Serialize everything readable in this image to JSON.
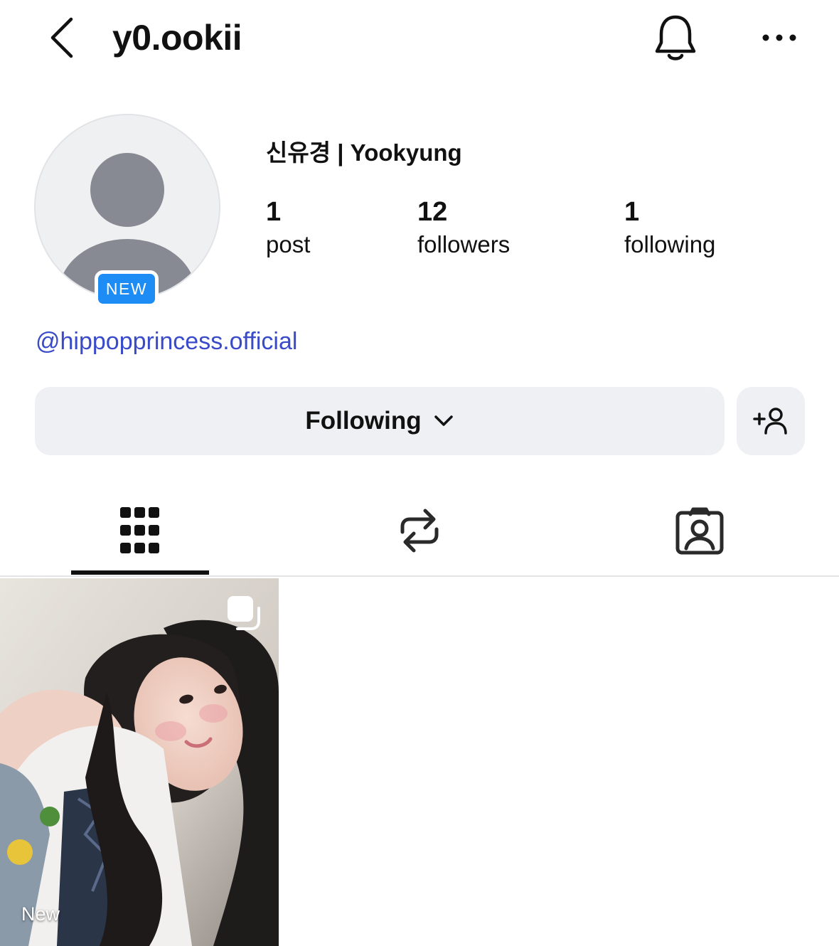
{
  "header": {
    "username": "y0.ookii",
    "back_icon": "chevron-left-icon",
    "notification_icon": "bell-icon",
    "more_icon": "more-horizontal-icon"
  },
  "profile": {
    "display_name": "신유경 | Yookyung",
    "avatar_badge": "NEW",
    "link": "@hippopprincess.official",
    "stats": {
      "posts": {
        "count": "1",
        "label": "post"
      },
      "followers": {
        "count": "12",
        "label": "followers"
      },
      "following": {
        "count": "1",
        "label": "following"
      }
    }
  },
  "actions": {
    "following_label": "Following",
    "following_icon": "chevron-down-icon",
    "add_user_icon": "add-user-icon"
  },
  "tabs": [
    {
      "icon": "grid-icon",
      "active": true
    },
    {
      "icon": "repost-icon",
      "active": false
    },
    {
      "icon": "tagged-icon",
      "active": false
    }
  ],
  "posts": [
    {
      "caption": "New",
      "type_icon": "carousel-icon"
    }
  ],
  "colors": {
    "accent_link": "#3a4bc9",
    "badge_blue": "#1d8cf5",
    "button_bg": "#eff0f3",
    "avatar_gray": "#878a93"
  }
}
